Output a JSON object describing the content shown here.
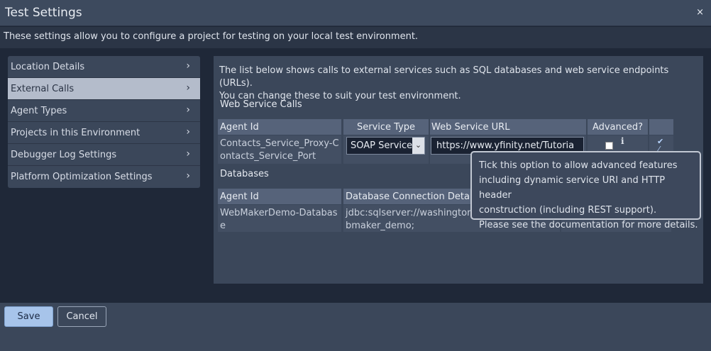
{
  "window": {
    "title": "Test Settings",
    "close_glyph": "×"
  },
  "info": {
    "text": "These settings allow you to configure a project for testing on your local test environment."
  },
  "sidebar": {
    "items": [
      {
        "label": "Location Details",
        "chevron": "›",
        "active": false
      },
      {
        "label": "External Calls",
        "chevron": "›",
        "active": true
      },
      {
        "label": "Agent Types",
        "chevron": "›",
        "active": false
      },
      {
        "label": "Projects in this Environment",
        "chevron": "›",
        "active": false
      },
      {
        "label": "Debugger Log Settings",
        "chevron": "›",
        "active": false
      },
      {
        "label": "Platform Optimization Settings",
        "chevron": "›",
        "active": false
      }
    ]
  },
  "main": {
    "intro_line1": "The list below shows calls to external services such as SQL databases and web service endpoints (URLs).",
    "intro_line2": "You can change these to suit your test environment.",
    "web_service": {
      "section_title": "Web Service Calls",
      "headers": [
        "Agent Id",
        "Service Type",
        "Web Service URL",
        "Advanced?"
      ],
      "row": {
        "agent_id_line1": "Contacts_Service_Proxy-C",
        "agent_id_line2": "ontacts_Service_Port",
        "service_type": "SOAP Service",
        "service_type_arrow": "⌄",
        "url": "https://www.yfinity.net/Tutoria",
        "advanced_checked": false,
        "info_glyph": "i",
        "tick_glyph": "✔"
      }
    },
    "databases": {
      "section_title": "Databases",
      "headers": [
        "Agent Id",
        "Database Connection Details"
      ],
      "row": {
        "agent_id_line1": "WebMakerDemo-Databas",
        "agent_id_line2": "e",
        "conn_line1": "jdbc:sqlserver://washington",
        "conn_line2": "bmaker_demo;"
      }
    }
  },
  "tooltip": {
    "line1": "Tick this option to allow advanced features",
    "line2": "including dynamic service URI and HTTP header",
    "line3": "construction (including REST support).",
    "line4": "Please see the documentation for more details."
  },
  "footer": {
    "save_label": "Save",
    "cancel_label": "Cancel"
  },
  "colors": {
    "accent": "#a7c4ea",
    "active_item": "#b4bccb",
    "panel": "#3b475a"
  }
}
